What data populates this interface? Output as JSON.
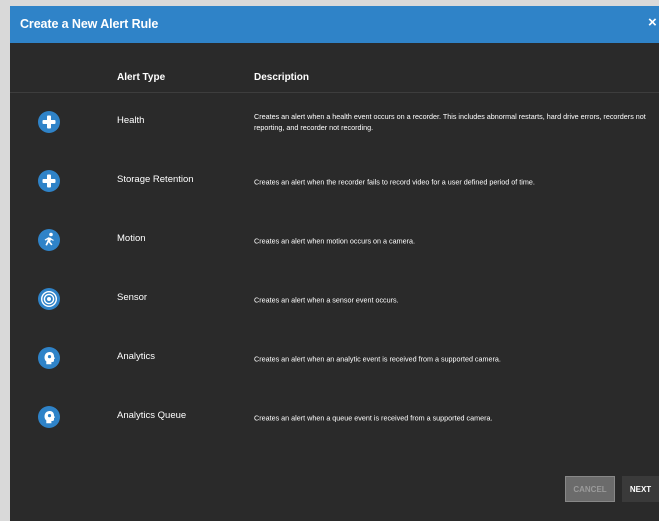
{
  "dialog": {
    "title": "Create a New Alert Rule",
    "close_symbol": "×"
  },
  "table": {
    "col_type": "Alert Type",
    "col_desc": "Description",
    "rows": [
      {
        "icon": "plus-circle-icon",
        "type": "Health",
        "desc": "Creates an alert when a health event occurs on a recorder. This includes abnormal restarts, hard drive errors, recorders not reporting, and recorder not recording."
      },
      {
        "icon": "plus-circle-icon",
        "type": "Storage Retention",
        "desc": "Creates an alert when the recorder fails to record video for a user defined period of time."
      },
      {
        "icon": "running-person-icon",
        "type": "Motion",
        "desc": "Creates an alert when motion occurs on a camera."
      },
      {
        "icon": "sensor-target-icon",
        "type": "Sensor",
        "desc": "Creates an alert when a sensor event occurs."
      },
      {
        "icon": "analytics-head-icon",
        "type": "Analytics",
        "desc": "Creates an alert when an analytic event is received from a supported camera."
      },
      {
        "icon": "analytics-head-icon",
        "type": "Analytics Queue",
        "desc": "Creates an alert when a queue event is received from a supported camera."
      }
    ]
  },
  "footer": {
    "cancel_label": "CANCEL",
    "next_label": "NEXT"
  },
  "colors": {
    "accent": "#2f83c8",
    "background": "#2a2a2a",
    "text": "#ffffff"
  }
}
